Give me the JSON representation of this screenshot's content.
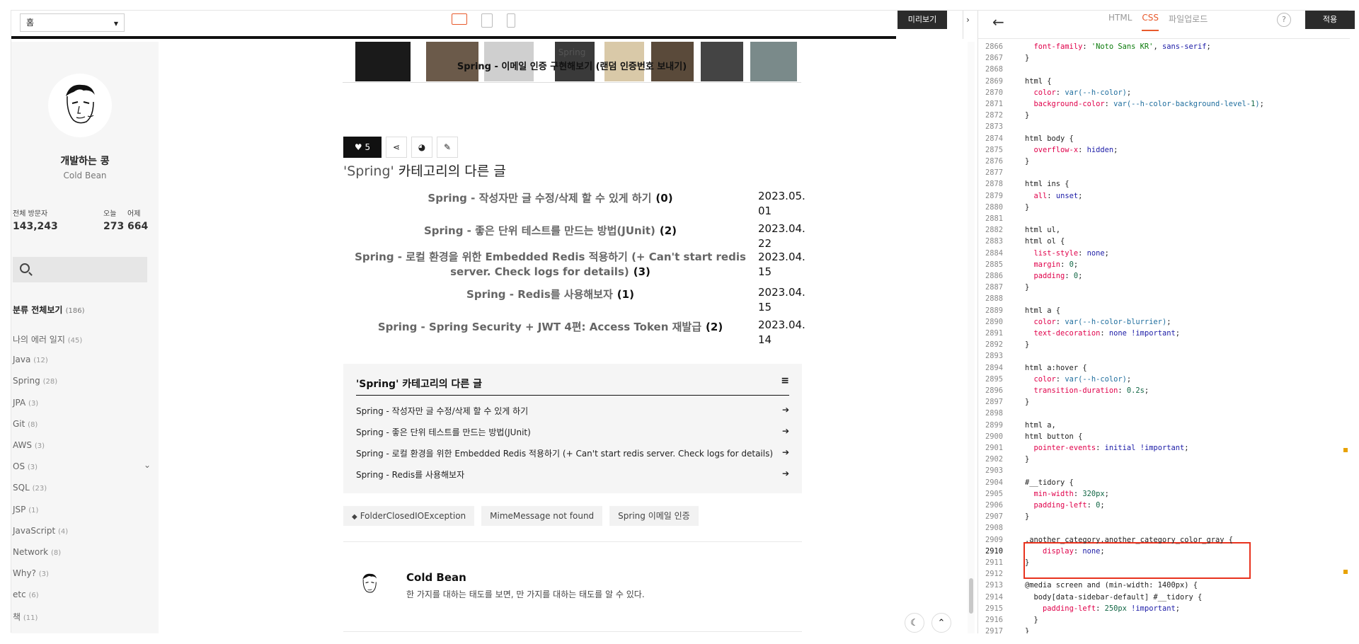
{
  "toolbar": {
    "page_select": "홈",
    "preview_label": "미리보기",
    "collapse_label": "›"
  },
  "sidebar": {
    "blog_name": "개발하는 콩",
    "blog_sub": "Cold Bean",
    "total_visitors_label": "전체 방문자",
    "total_visitors": "143,243",
    "today_label": "오늘",
    "today": "273",
    "yesterday_label": "어제",
    "yesterday": "664",
    "search_placeholder": "",
    "category_all_label": "분류 전체보기",
    "category_all_count": "(186)",
    "categories": [
      {
        "name": "나의 에러 일지",
        "count": "(45)"
      },
      {
        "name": "Java",
        "count": "(12)"
      },
      {
        "name": "Spring",
        "count": "(28)"
      },
      {
        "name": "JPA",
        "count": "(3)"
      },
      {
        "name": "Git",
        "count": "(8)"
      },
      {
        "name": "AWS",
        "count": "(3)"
      },
      {
        "name": "OS",
        "count": "(3)"
      },
      {
        "name": "SQL",
        "count": "(23)"
      },
      {
        "name": "JSP",
        "count": "(1)"
      },
      {
        "name": "JavaScript",
        "count": "(4)"
      },
      {
        "name": "Network",
        "count": "(8)"
      },
      {
        "name": "Why?",
        "count": "(3)"
      },
      {
        "name": "etc",
        "count": "(6)"
      },
      {
        "name": "책",
        "count": "(11)"
      }
    ]
  },
  "post": {
    "banner_category": "Spring",
    "banner_title": "Spring - 이메일 인증 구현해보기 (랜덤 인증번호 보내기)",
    "like_count": "5",
    "other_heading_quote": "'Spring'",
    "other_heading_rest": " 카테고리의 다른 글",
    "other_posts": [
      {
        "title": "Spring - 작성자만 글 수정/삭제 할 수 있게 하기",
        "count": "(0)",
        "date_a": "2023.05.",
        "date_b": "01"
      },
      {
        "title": "Spring - 좋은 단위 테스트를 만드는 방법(JUnit)",
        "count": "(2)",
        "date_a": "2023.04.",
        "date_b": "22"
      },
      {
        "title": "Spring - 로컬 환경을 위한 Embedded Redis 적용하기 (+ Can't start redis server. Check logs for details)",
        "count": "(3)",
        "date_a": "2023.04.",
        "date_b": "15"
      },
      {
        "title": "Spring - Redis를 사용해보자",
        "count": "(1)",
        "date_a": "2023.04.",
        "date_b": "15"
      },
      {
        "title": "Spring - Spring Security + JWT 4편: Access Token 재발급",
        "count": "(2)",
        "date_a": "2023.04.",
        "date_b": "14"
      }
    ],
    "cat_box_title": "'Spring' 카테고리의 다른 글",
    "cat_box_items": [
      "Spring - 작성자만 글 수정/삭제 할 수 있게 하기",
      "Spring - 좋은 단위 테스트를 만드는 방법(JUnit)",
      "Spring - 로컬 환경을 위한 Embedded Redis 적용하기 (+ Can't start redis server. Check logs for details)",
      "Spring - Redis를 사용해보자"
    ],
    "tags": [
      "FolderClosedIOException",
      "MimeMessage not found",
      "Spring 이메일 인증"
    ],
    "author_name": "Cold Bean",
    "author_desc": "한 가지를 대하는 태도를 보면, 만 가지를 대하는 태도를 알 수 있다."
  },
  "editor": {
    "tabs": [
      "HTML",
      "CSS",
      "파일업로드"
    ],
    "active_tab": "CSS",
    "help_label": "?",
    "apply_label": "적용",
    "lines": [
      {
        "n": "2866",
        "code": "  font-family: 'Noto Sans KR', sans-serif;"
      },
      {
        "n": "2867",
        "code": "}"
      },
      {
        "n": "2868",
        "code": ""
      },
      {
        "n": "2869",
        "code": "html {"
      },
      {
        "n": "2870",
        "code": "  color: var(--h-color);"
      },
      {
        "n": "2871",
        "code": "  background-color: var(--h-color-background-level-1);"
      },
      {
        "n": "2872",
        "code": "}"
      },
      {
        "n": "2873",
        "code": ""
      },
      {
        "n": "2874",
        "code": "html body {"
      },
      {
        "n": "2875",
        "code": "  overflow-x: hidden;"
      },
      {
        "n": "2876",
        "code": "}"
      },
      {
        "n": "2877",
        "code": ""
      },
      {
        "n": "2878",
        "code": "html ins {"
      },
      {
        "n": "2879",
        "code": "  all: unset;"
      },
      {
        "n": "2880",
        "code": "}"
      },
      {
        "n": "2881",
        "code": ""
      },
      {
        "n": "2882",
        "code": "html ul,"
      },
      {
        "n": "2883",
        "code": "html ol {"
      },
      {
        "n": "2884",
        "code": "  list-style: none;"
      },
      {
        "n": "2885",
        "code": "  margin: 0;"
      },
      {
        "n": "2886",
        "code": "  padding: 0;"
      },
      {
        "n": "2887",
        "code": "}"
      },
      {
        "n": "2888",
        "code": ""
      },
      {
        "n": "2889",
        "code": "html a {"
      },
      {
        "n": "2890",
        "code": "  color: var(--h-color-blurrier);"
      },
      {
        "n": "2891",
        "code": "  text-decoration: none !important;"
      },
      {
        "n": "2892",
        "code": "}"
      },
      {
        "n": "2893",
        "code": ""
      },
      {
        "n": "2894",
        "code": "html a:hover {"
      },
      {
        "n": "2895",
        "code": "  color: var(--h-color);"
      },
      {
        "n": "2896",
        "code": "  transition-duration: 0.2s;"
      },
      {
        "n": "2897",
        "code": "}"
      },
      {
        "n": "2898",
        "code": ""
      },
      {
        "n": "2899",
        "code": "html a,"
      },
      {
        "n": "2900",
        "code": "html button {"
      },
      {
        "n": "2901",
        "code": "  pointer-events: initial !important;"
      },
      {
        "n": "2902",
        "code": "}"
      },
      {
        "n": "2903",
        "code": ""
      },
      {
        "n": "2904",
        "code": "#__tidory {"
      },
      {
        "n": "2905",
        "code": "  min-width: 320px;"
      },
      {
        "n": "2906",
        "code": "  padding-left: 0;"
      },
      {
        "n": "2907",
        "code": "}"
      },
      {
        "n": "2908",
        "code": ""
      },
      {
        "n": "2909",
        "code": ".another_category.another_category_color_gray {"
      },
      {
        "n": "2910",
        "code": "    display: none;"
      },
      {
        "n": "2911",
        "code": "}"
      },
      {
        "n": "2912",
        "code": ""
      },
      {
        "n": "2913",
        "code": "@media screen and (min-width: 1400px) {"
      },
      {
        "n": "2914",
        "code": "  body[data-sidebar-default] #__tidory {"
      },
      {
        "n": "2915",
        "code": "    padding-left: 250px !important;"
      },
      {
        "n": "2916",
        "code": "  }"
      },
      {
        "n": "2917",
        "code": "}"
      }
    ],
    "current_line": "2910"
  }
}
